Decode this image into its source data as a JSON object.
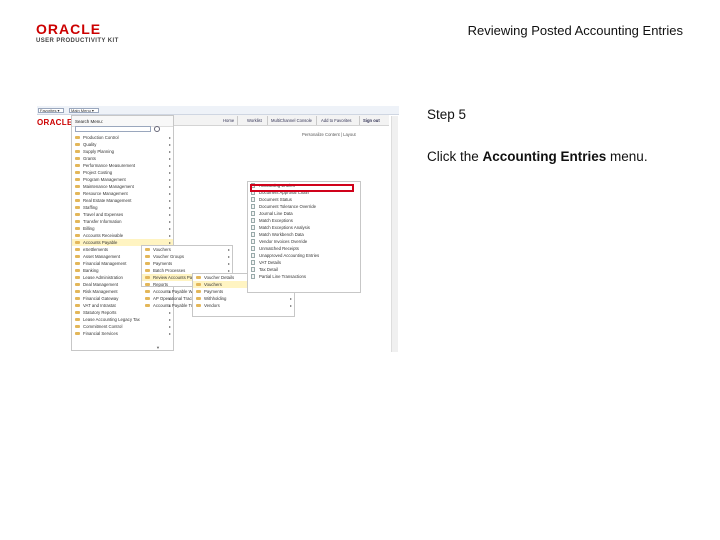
{
  "header": {
    "logo_brand": "ORACLE",
    "logo_sub": "USER PRODUCTIVITY KIT",
    "title": "Reviewing Posted Accounting Entries"
  },
  "instructions": {
    "step": "Step 5",
    "text_before": "Click the ",
    "text_bold": "Accounting Entries",
    "text_after": " menu."
  },
  "screenshot": {
    "topbar": {
      "favorites": "Favorites ▾",
      "main_menu": "Main Menu ▾"
    },
    "nav_links": [
      "Home",
      "Worklist",
      "MultiChannel Console",
      "Add to Favorites",
      "Sign out"
    ],
    "mini_logo": "ORACLE",
    "personalize": "Personalize Content | Layout",
    "search": {
      "label": "Search Menu:"
    },
    "main_menu_items": [
      "Production Control",
      "Quality",
      "Supply Planning",
      "Grants",
      "Performance Measurement",
      "Project Costing",
      "Program Management",
      "Maintenance Management",
      "Resource Management",
      "Real Estate Management",
      "Staffing",
      "Travel and Expenses",
      "Transfer Information",
      "Billing",
      "Accounts Receivable",
      "Accounts Payable",
      "eSettlements",
      "Asset Management",
      "Financial Management",
      "Banking",
      "Lease Administration",
      "Deal Management",
      "Risk Management",
      "Financial Gateway",
      "VAT and Intrastat",
      "Statutory Reports",
      "Lease Accounting Legacy Tax",
      "Commitment Control",
      "Financial Services"
    ],
    "highlight_index": 15,
    "sub_menu_1": [
      "Vouchers",
      "Voucher Groups",
      "Payments",
      "Batch Processes",
      "Review Accounts Payable Info",
      "Reports",
      "Accounts Payable Web Services",
      "AP Operational Tracking",
      "Accounts Payable Transactions"
    ],
    "sub_menu_1_highlight": 4,
    "sub_menu_2": [
      "Voucher Details",
      "Vouchers",
      "Payments",
      "Withholding",
      "Vendors"
    ],
    "sub_menu_2_highlight": 1,
    "sub_menu_3": [
      "Accounting Entries",
      "Document Approval Chain",
      "Document Status",
      "Document Tolerance Override",
      "Journal Line Data",
      "Match Exceptions",
      "Match Exceptions Analysis",
      "Match Workbench Data",
      "Vendor Invoices Override",
      "Unmatched Receipts",
      "Unapproved Accounting Entries",
      "VAT Details",
      "Tax Detail",
      "Partial Line Transactions"
    ]
  }
}
